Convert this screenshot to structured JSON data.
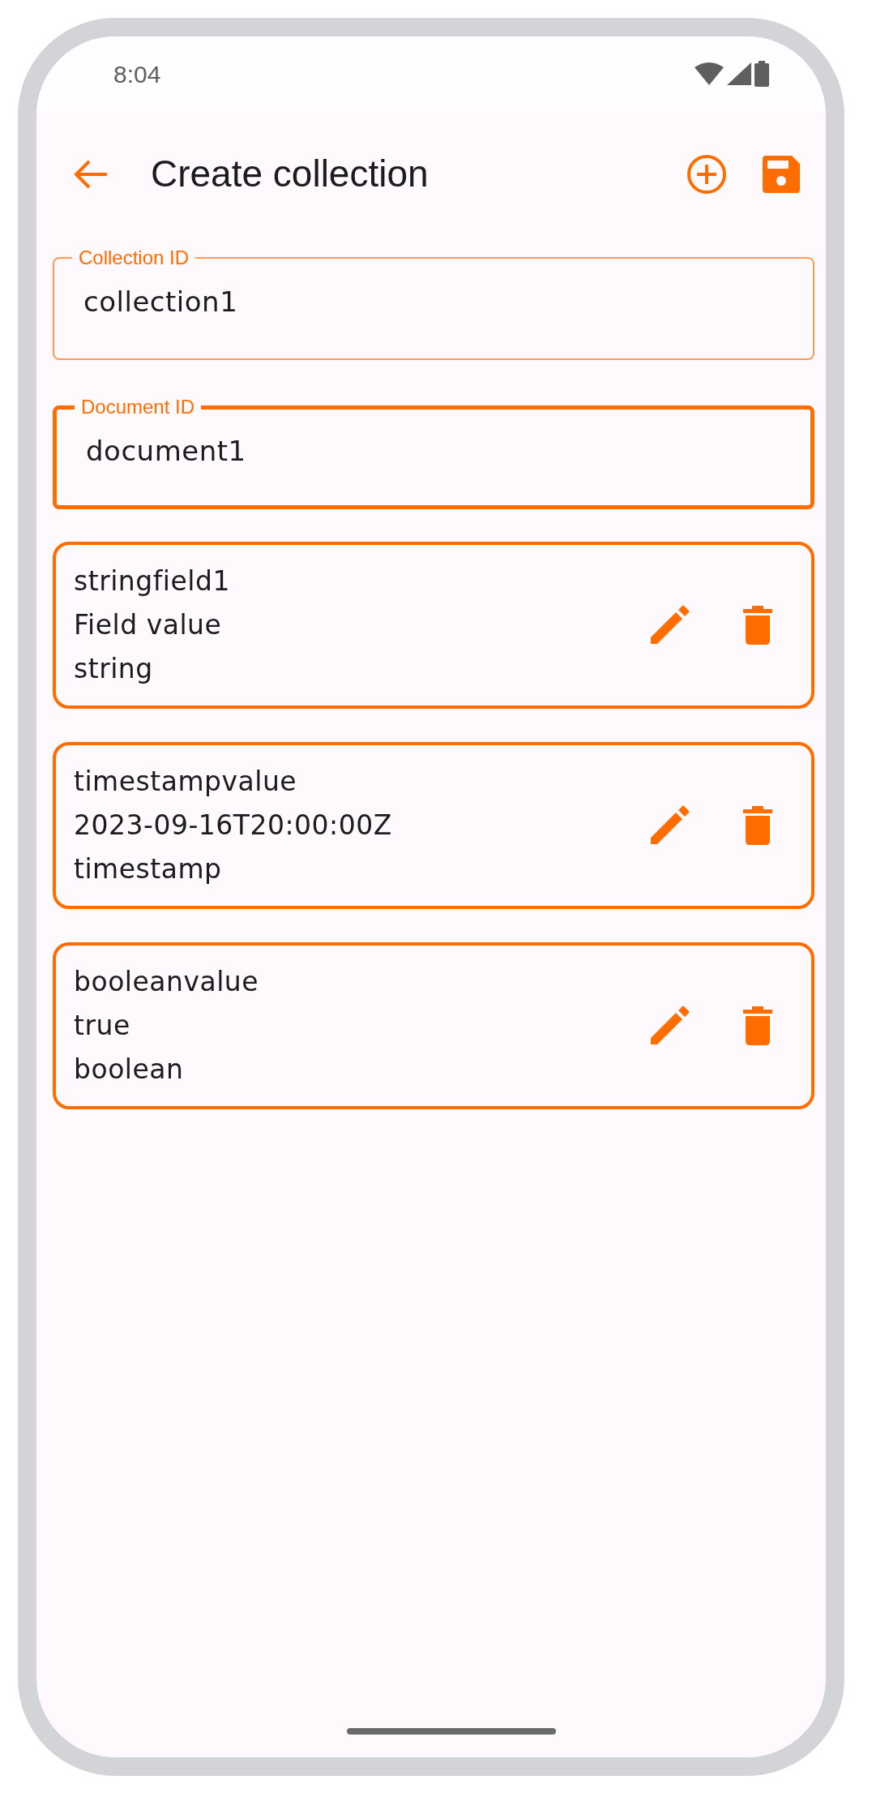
{
  "status_bar": {
    "time": "8:04"
  },
  "app_bar": {
    "title": "Create collection"
  },
  "inputs": [
    {
      "label": "Collection ID",
      "value": "collection1",
      "focused": false
    },
    {
      "label": "Document ID",
      "value": "document1",
      "focused": true
    }
  ],
  "fields": [
    {
      "name": "stringfield1",
      "value": "Field value",
      "type": "string"
    },
    {
      "name": "timestampvalue",
      "value": "2023-09-16T20:00:00Z",
      "type": "timestamp"
    },
    {
      "name": "booleanvalue",
      "value": "true",
      "type": "boolean"
    }
  ]
}
